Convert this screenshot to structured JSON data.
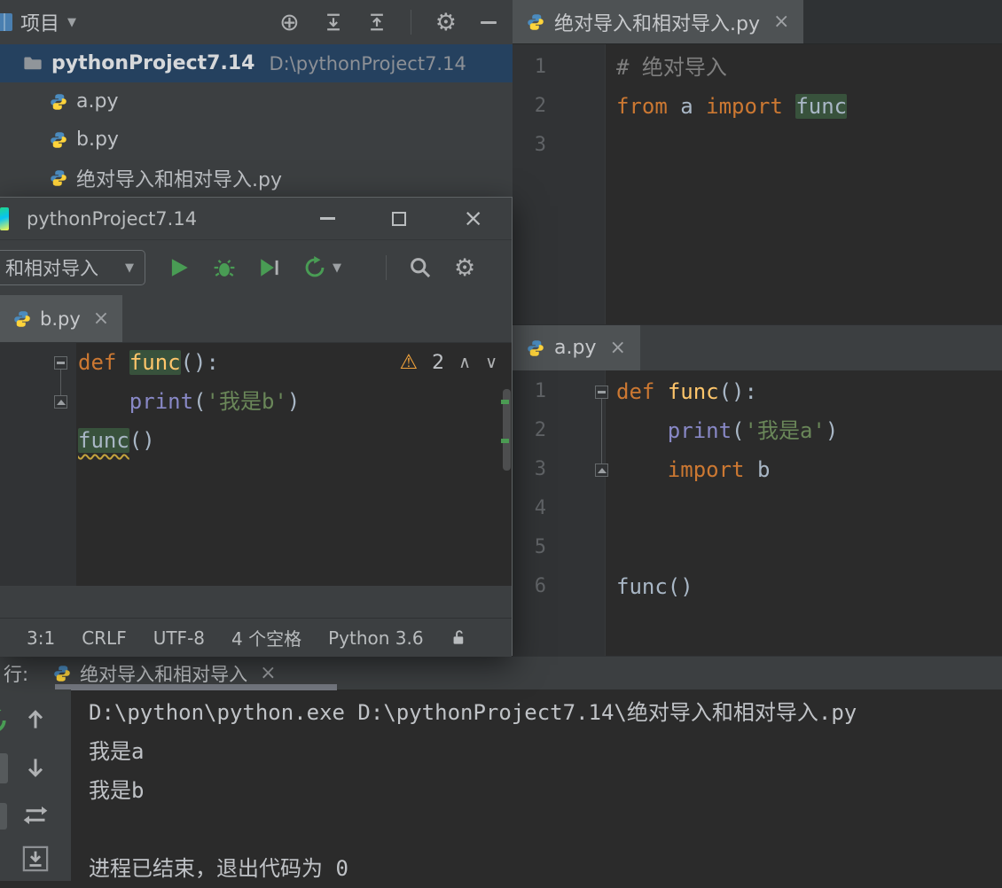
{
  "top_toolbar": {
    "project_label": "项目",
    "caret": "▼",
    "locate_glyph": "⊕",
    "gear_glyph": "⚙"
  },
  "main_tab": {
    "label": "绝对导入和相对导入.py",
    "close": "×"
  },
  "project": {
    "root_name": "pythonProject7.14",
    "root_path": "D:\\pythonProject7.14",
    "files": [
      {
        "label": "a.py"
      },
      {
        "label": "b.py"
      },
      {
        "label": "绝对导入和相对导入.py"
      }
    ]
  },
  "editor_main": {
    "line_numbers": [
      "1",
      "2",
      "3"
    ],
    "l1_comment": "# 绝对导入",
    "l2": {
      "kw1": "from",
      "mid": " a ",
      "kw2": "import",
      "sp": " ",
      "id": "func"
    }
  },
  "fwin": {
    "title": "pythonProject7.14",
    "close_glyph": "×",
    "run_config": "和相对导入",
    "caret": "▼",
    "tab": {
      "label": "b.py",
      "close": "×"
    },
    "code": {
      "l1": {
        "kw": "def",
        "sp": " ",
        "name": "func",
        "rest": "():"
      },
      "l2": {
        "indent": "    ",
        "builtin": "print",
        "open": "(",
        "str": "'我是b'",
        "close": ")"
      },
      "l3": {
        "name": "func",
        "rest": "()"
      }
    },
    "warning": {
      "glyph": "⚠",
      "count": "2",
      "up": "∧",
      "down": "∨"
    },
    "status": {
      "pos": "3:1",
      "eol": "CRLF",
      "enc": "UTF-8",
      "indent": "4 个空格",
      "py": "Python 3.6"
    }
  },
  "editor_a": {
    "tab": {
      "label": "a.py",
      "close": "×"
    },
    "line_numbers": [
      "1",
      "2",
      "3",
      "4",
      "5",
      "6"
    ],
    "l1": {
      "kw": "def",
      "sp": " ",
      "name": "func",
      "rest": "():"
    },
    "l2": {
      "indent": "    ",
      "builtin": "print",
      "open": "(",
      "str": "'我是a'",
      "close": ")"
    },
    "l3": {
      "indent": "    ",
      "kw": "import",
      "rest": " b"
    },
    "l6": "func()"
  },
  "run": {
    "tab_prefix": "行:",
    "tab": {
      "label": "绝对导入和相对导入",
      "close": "×"
    },
    "console": [
      "D:\\python\\python.exe D:\\pythonProject7.14\\绝对导入和相对导入.py",
      "我是a",
      "我是b",
      "",
      "进程已结束，退出代码为 0"
    ]
  }
}
